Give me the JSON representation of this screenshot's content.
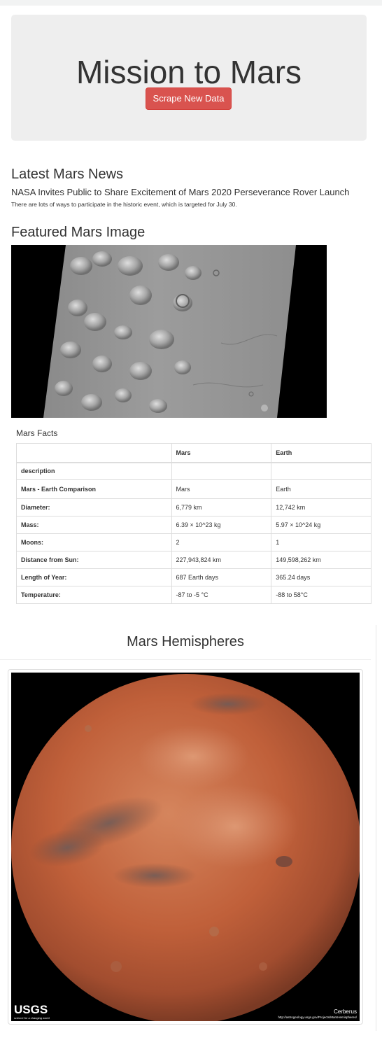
{
  "jumbotron": {
    "title": "Mission to Mars",
    "scrape_button_label": "Scrape New Data"
  },
  "news": {
    "section_title": "Latest Mars News",
    "headline": "NASA Invites Public to Share Excitement of Mars 2020 Perseverance Rover Launch",
    "teaser": "There are lots of ways to participate in the historic event, which is targeted for July 30."
  },
  "featured": {
    "section_title": "Featured Mars Image"
  },
  "facts": {
    "caption": "Mars Facts",
    "columns": [
      "",
      "Mars",
      "Earth"
    ],
    "index_label": "description",
    "rows": [
      {
        "label": "Mars - Earth Comparison",
        "mars": "Mars",
        "earth": "Earth"
      },
      {
        "label": "Diameter:",
        "mars": "6,779 km",
        "earth": "12,742 km"
      },
      {
        "label": "Mass:",
        "mars": "6.39 × 10^23 kg",
        "earth": "5.97 × 10^24 kg"
      },
      {
        "label": "Moons:",
        "mars": "2",
        "earth": "1"
      },
      {
        "label": "Distance from Sun:",
        "mars": "227,943,824 km",
        "earth": "149,598,262 km"
      },
      {
        "label": "Length of Year:",
        "mars": "687 Earth days",
        "earth": "365.24 days"
      },
      {
        "label": "Temperature:",
        "mars": "-87 to -5 °C",
        "earth": "-88 to 58°C"
      }
    ]
  },
  "hemispheres": {
    "section_title": "Mars Hemispheres",
    "thumbnail": {
      "logo_text": "USGS",
      "logo_tagline": "science for a changing world",
      "hemisphere_name": "Cerberus",
      "credit_url": "http://astrogeology.usgs.gov/Projects/MarsHemispheres/"
    }
  },
  "colors": {
    "button_bg": "#d9534f",
    "jumbotron_bg": "#eeeeee",
    "mars_surface": "#c0603a"
  }
}
